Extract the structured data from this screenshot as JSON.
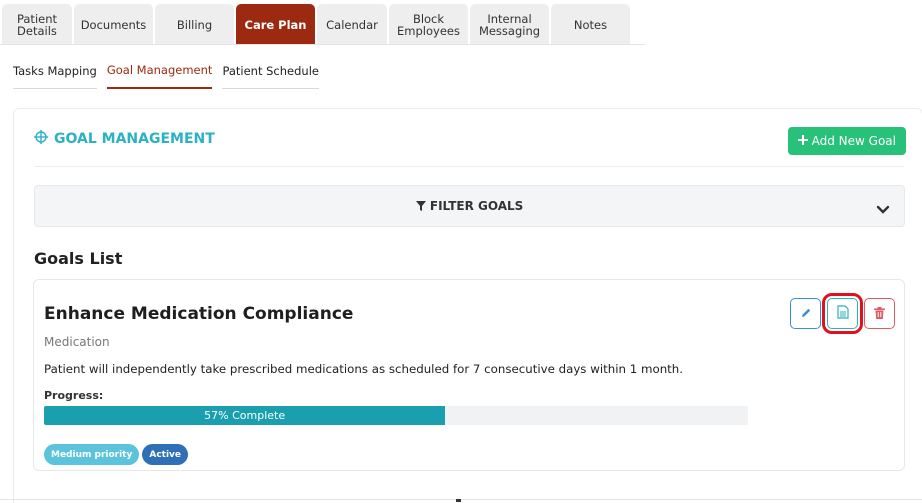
{
  "tabs": [
    {
      "label_line1": "Patient",
      "label_line2": "Details",
      "width": 70,
      "active": false
    },
    {
      "label_line1": "Documents",
      "label_line2": "",
      "width": 79,
      "active": false
    },
    {
      "label_line1": "Billing",
      "label_line2": "",
      "width": 79,
      "active": false
    },
    {
      "label_line1": "Care Plan",
      "label_line2": "",
      "width": 79,
      "active": true
    },
    {
      "label_line1": "Calendar",
      "label_line2": "",
      "width": 70,
      "active": false
    },
    {
      "label_line1": "Block",
      "label_line2": "Employees",
      "width": 79,
      "active": false
    },
    {
      "label_line1": "Internal",
      "label_line2": "Messaging",
      "width": 79,
      "active": false
    },
    {
      "label_line1": "Notes",
      "label_line2": "",
      "width": 79,
      "active": false
    }
  ],
  "subtabs": {
    "tasks_mapping": "Tasks Mapping",
    "goal_management": "Goal Management",
    "patient_schedule": "Patient Schedule"
  },
  "header": {
    "title": "GOAL MANAGEMENT",
    "add_button": "Add New Goal"
  },
  "filter": {
    "label": "FILTER GOALS"
  },
  "goals_list": {
    "title": "Goals List",
    "goal": {
      "name": "Enhance Medication Compliance",
      "category": "Medication",
      "description": "Patient will independently take prescribed medications as scheduled for 7 consecutive days within 1 month.",
      "progress_label": "Progress:",
      "progress_fraction": 0.57,
      "progress_text": "57% Complete",
      "priority": "Medium priority",
      "status": "Active"
    }
  },
  "colors": {
    "brand_active_tab": "#9b2a10",
    "accent_teal": "#2bb1c4",
    "add_green": "#27c17a",
    "progress_fill": "#1a9fae",
    "highlight_red": "#e0111c"
  },
  "icons": {
    "title_icon": "crosshair-icon",
    "add_icon": "plus-icon",
    "filter_icon": "filter-icon",
    "chevron": "chevron-down-icon",
    "edit": "pencil-icon",
    "doc": "document-icon",
    "delete": "trash-icon"
  }
}
